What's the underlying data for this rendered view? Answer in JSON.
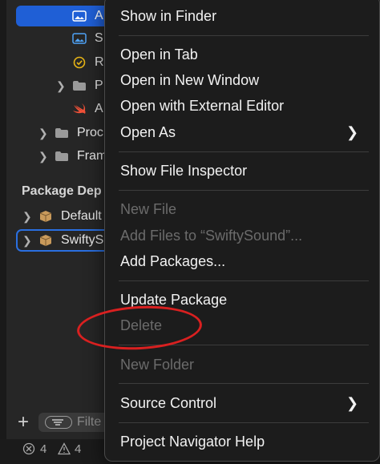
{
  "navigator": {
    "rows": [
      {
        "label": "A",
        "icon": "image-asset-icon"
      },
      {
        "label": "S",
        "icon": "image-asset-icon"
      },
      {
        "label": "R",
        "icon": "badge-icon"
      },
      {
        "label": "P",
        "icon": "folder-icon"
      },
      {
        "label": "A",
        "icon": "swift-icon"
      },
      {
        "label": "Proc",
        "icon": "folder-icon"
      },
      {
        "label": "Fram",
        "icon": "folder-icon"
      }
    ],
    "section_header": "Package Dep",
    "packages": [
      {
        "label": "Default",
        "icon": "package-icon"
      },
      {
        "label": "SwiftyS",
        "icon": "package-icon"
      }
    ],
    "filter_placeholder": "Filte",
    "add_label": "+"
  },
  "status": {
    "errors": "4",
    "warnings": "4"
  },
  "context_menu": {
    "items": [
      {
        "label": "Show in Finder",
        "enabled": true
      },
      {
        "label": "Open in Tab",
        "enabled": true
      },
      {
        "label": "Open in New Window",
        "enabled": true
      },
      {
        "label": "Open with External Editor",
        "enabled": true
      },
      {
        "label": "Open As",
        "enabled": true,
        "submenu": true
      },
      {
        "label": "Show File Inspector",
        "enabled": true
      },
      {
        "label": "New File",
        "enabled": false
      },
      {
        "label": "Add Files to “SwiftySound”...",
        "enabled": false
      },
      {
        "label": "Add Packages...",
        "enabled": true
      },
      {
        "label": "Update Package",
        "enabled": true
      },
      {
        "label": "Delete",
        "enabled": false
      },
      {
        "label": "New Folder",
        "enabled": false
      },
      {
        "label": "Source Control",
        "enabled": true,
        "submenu": true
      },
      {
        "label": "Project Navigator Help",
        "enabled": true
      }
    ]
  },
  "colors": {
    "selection": "#1f5fd6",
    "annotation": "#d92020"
  }
}
